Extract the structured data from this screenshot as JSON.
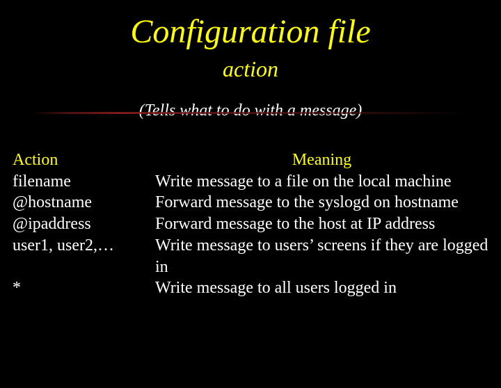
{
  "title": "Configuration file",
  "subtitle": "action",
  "note": "(Tells what to do with a message)",
  "headers": {
    "action": "Action",
    "meaning": "Meaning"
  },
  "rows": [
    {
      "action": "filename",
      "meaning": "Write message to a file on the local machine"
    },
    {
      "action": "@hostname",
      "meaning": "Forward message  to the syslogd on hostname"
    },
    {
      "action": "@ipaddress",
      "meaning": "Forward message to the host at IP address"
    },
    {
      "action": "user1, user2,…",
      "meaning": "Write message to users’ screens if they are logged in"
    },
    {
      "action": "*",
      "meaning": "Write message to all users logged in"
    }
  ]
}
